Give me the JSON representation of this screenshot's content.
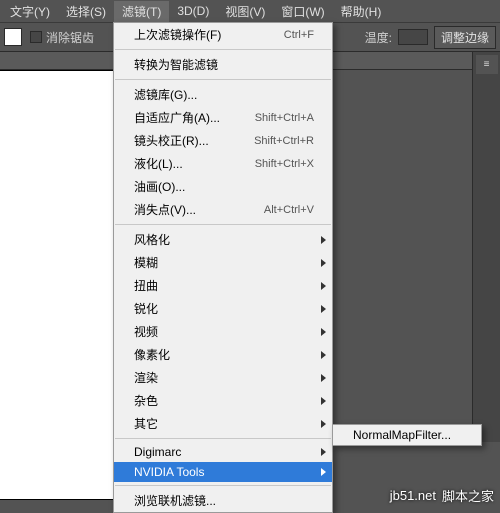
{
  "menubar": {
    "items": [
      "文字(Y)",
      "选择(S)",
      "滤镜(T)",
      "3D(D)",
      "视图(V)",
      "窗口(W)",
      "帮助(H)"
    ]
  },
  "toolbar": {
    "antialias": "消除锯齿",
    "temperature": "温度:",
    "adjust_edge": "调整边缘"
  },
  "filter_menu": {
    "last_filter": "上次滤镜操作(F)",
    "last_filter_shortcut": "Ctrl+F",
    "convert_smart": "转换为智能滤镜",
    "filter_gallery": "滤镜库(G)...",
    "adaptive_wide": "自适应广角(A)...",
    "adaptive_wide_shortcut": "Shift+Ctrl+A",
    "lens_correction": "镜头校正(R)...",
    "lens_correction_shortcut": "Shift+Ctrl+R",
    "liquify": "液化(L)...",
    "liquify_shortcut": "Shift+Ctrl+X",
    "oil_paint": "油画(O)...",
    "vanishing_point": "消失点(V)...",
    "vanishing_point_shortcut": "Alt+Ctrl+V",
    "stylize": "风格化",
    "blur": "模糊",
    "distort": "扭曲",
    "sharpen": "锐化",
    "video": "视频",
    "pixelate": "像素化",
    "render": "渲染",
    "noise": "杂色",
    "other": "其它",
    "digimarc": "Digimarc",
    "nvidia": "NVIDIA Tools",
    "browse_online": "浏览联机滤镜..."
  },
  "submenu": {
    "normal_map": "NormalMapFilter..."
  },
  "watermark": {
    "url": "jb51.net",
    "name": "脚本之家"
  }
}
